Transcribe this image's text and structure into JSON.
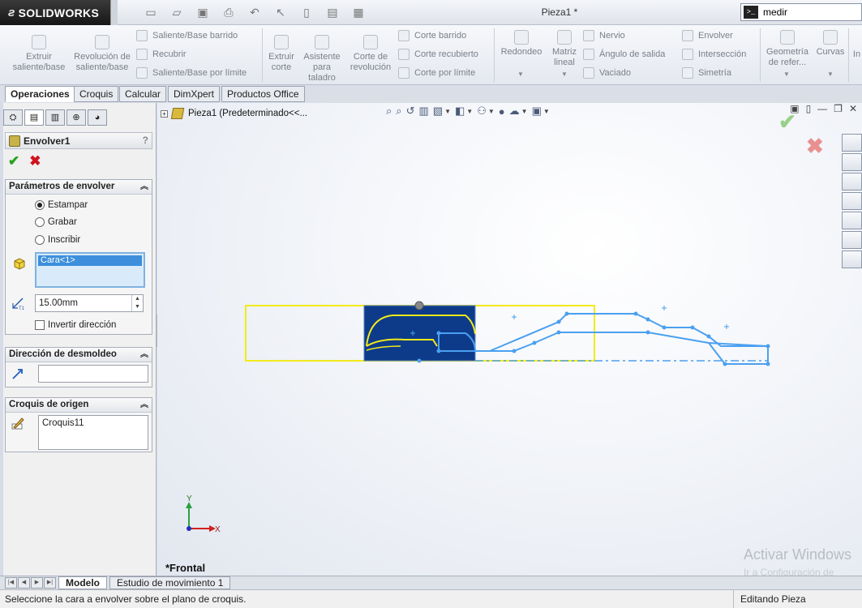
{
  "app": {
    "brand": "SOLIDWORKS",
    "document_title": "Pieza1 *"
  },
  "search": {
    "value": "medir"
  },
  "ribbon": {
    "extruir_saliente": "Extruir saliente/base",
    "revolucion_saliente": "Revolución de saliente/base",
    "saliente_barrido": "Saliente/Base barrido",
    "recubrir": "Recubrir",
    "saliente_limite": "Saliente/Base por límite",
    "extruir_corte": "Extruir corte",
    "asistente_taladro": "Asistente para taladro",
    "corte_revolucion": "Corte de revolución",
    "corte_barrido": "Corte barrido",
    "corte_recubierto": "Corte recubierto",
    "corte_limite": "Corte por límite",
    "redondeo": "Redondeo",
    "matriz_lineal": "Matriz lineal",
    "nervio": "Nervio",
    "angulo_salida": "Ángulo de salida",
    "vaciado": "Vaciado",
    "envolver": "Envolver",
    "interseccion": "Intersección",
    "simetria": "Simetría",
    "geometria_ref": "Geometría de refer...",
    "curvas": "Curvas",
    "cut_off": "In"
  },
  "tabs": [
    "Operaciones",
    "Croquis",
    "Calcular",
    "DimXpert",
    "Productos Office"
  ],
  "property_manager": {
    "title": "Envolver1",
    "help": "?",
    "params_header": "Parámetros de envolver",
    "options": [
      "Estampar",
      "Grabar",
      "Inscribir"
    ],
    "selected_option": "Estampar",
    "face_selection": "Cara<1>",
    "thickness": "15.00mm",
    "reverse_direction": "Invertir dirección",
    "pull_direction_header": "Dirección de desmoldeo",
    "source_sketch_header": "Croquis de origen",
    "source_sketch": "Croquis11"
  },
  "tree": {
    "root": "Pieza1  (Predeterminado<<..."
  },
  "graphics": {
    "view_name": "*Frontal",
    "watermark": "Activar Windows",
    "watermark_sub": "Ir a Configuración de"
  },
  "axes": {
    "x": "X",
    "y": "Y"
  },
  "bottom_tabs": [
    "Modelo",
    "Estudio de movimiento 1"
  ],
  "status": {
    "message": "Seleccione la cara a envolver sobre el plano de croquis.",
    "state": "Editando Pieza"
  }
}
